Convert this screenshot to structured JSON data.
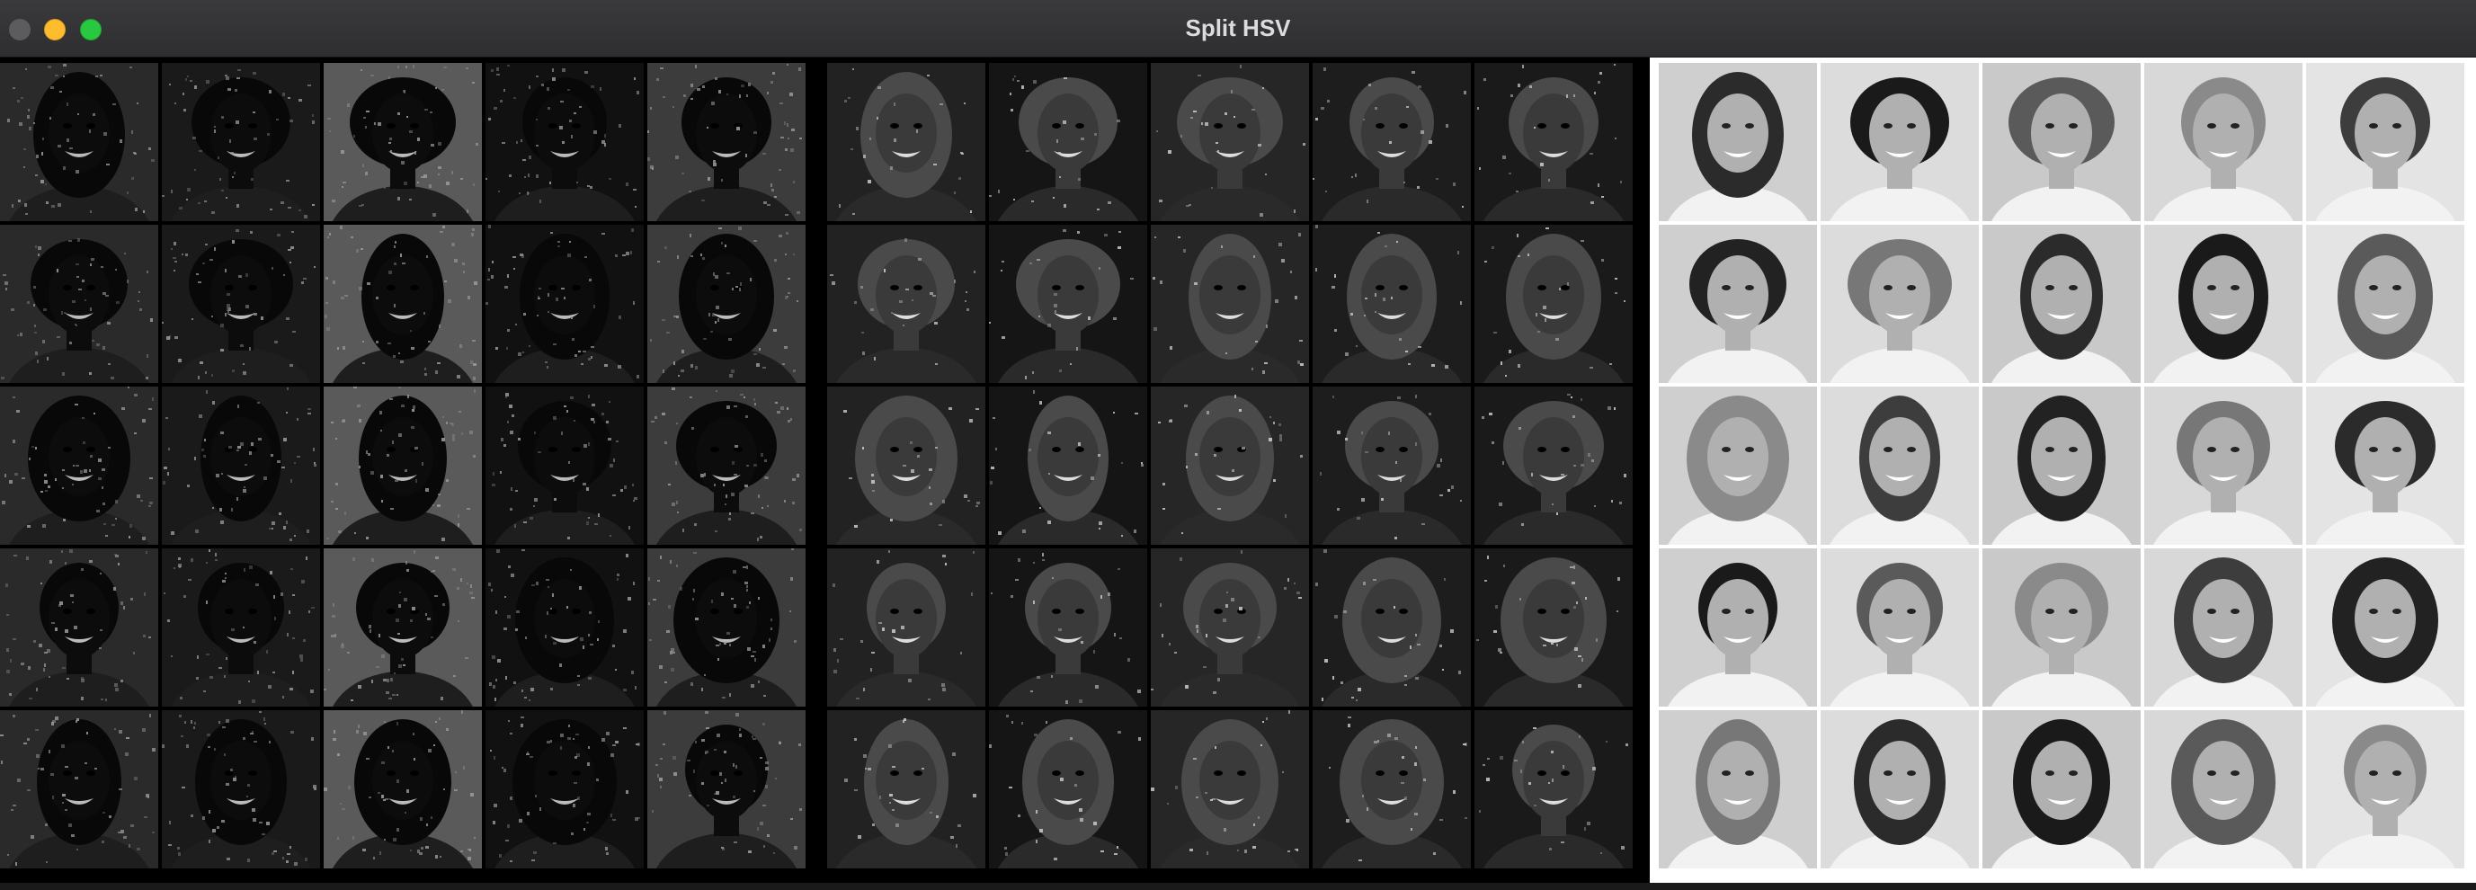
{
  "window": {
    "title": "Split HSV"
  },
  "panels": [
    {
      "channel": "hue",
      "tone": "dark-noisy"
    },
    {
      "channel": "saturation",
      "tone": "dark-gray"
    },
    {
      "channel": "value",
      "tone": "grayscale"
    }
  ],
  "grid": {
    "rows": 5,
    "cols": 5
  },
  "icons": {
    "close": "close-dot-icon",
    "minimize": "minimize-dot-icon",
    "maximize": "maximize-dot-icon"
  },
  "colors": {
    "minimize": "#febc2e",
    "maximize": "#28c840",
    "close": "#5c5c5e"
  }
}
